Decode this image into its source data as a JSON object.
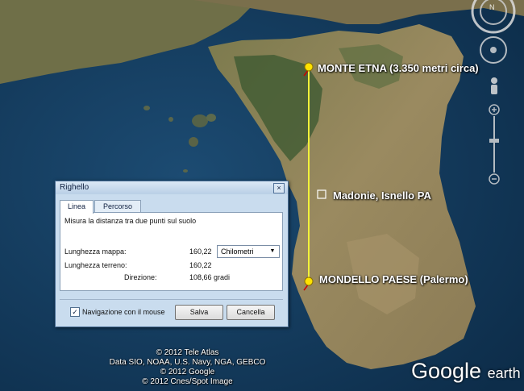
{
  "map_labels": {
    "etna": "MONTE ETNA (3.350 metri circa)",
    "madonie": "Madonie, Isnello PA",
    "mondello": "MONDELLO PAESE (Palermo)"
  },
  "copyright": [
    "© 2012 Tele Atlas",
    "Data SIO, NOAA, U.S. Navy, NGA, GEBCO",
    "© 2012 Google",
    "© 2012 Cnes/Spot Image"
  ],
  "logo": {
    "google": "Google",
    "earth": "earth"
  },
  "dialog": {
    "title": "Righello",
    "close": "×",
    "tabs": [
      "Linea",
      "Percorso"
    ],
    "description": "Misura la distanza tra due punti sul suolo",
    "map_length_label": "Lunghezza mappa:",
    "map_length_value": "160,22",
    "unit": "Chilometri",
    "ground_length_label": "Lunghezza terreno:",
    "ground_length_value": "160,22",
    "direction_label": "Direzione:",
    "direction_value": "108,66 gradi",
    "checkbox_label": "Navigazione con il mouse",
    "checkbox_mark": "✓",
    "save": "Salva",
    "cancel": "Cancella"
  },
  "colors": {
    "ruler_line": "#f2f23a",
    "pin": "#ffe200",
    "land": "#8a7a52",
    "sea": "#123a5c"
  },
  "icons": [
    "compass-ring-icon",
    "pan-arrows-icon",
    "pegman-icon",
    "zoom-slider-icon",
    "pushpin-icon"
  ]
}
